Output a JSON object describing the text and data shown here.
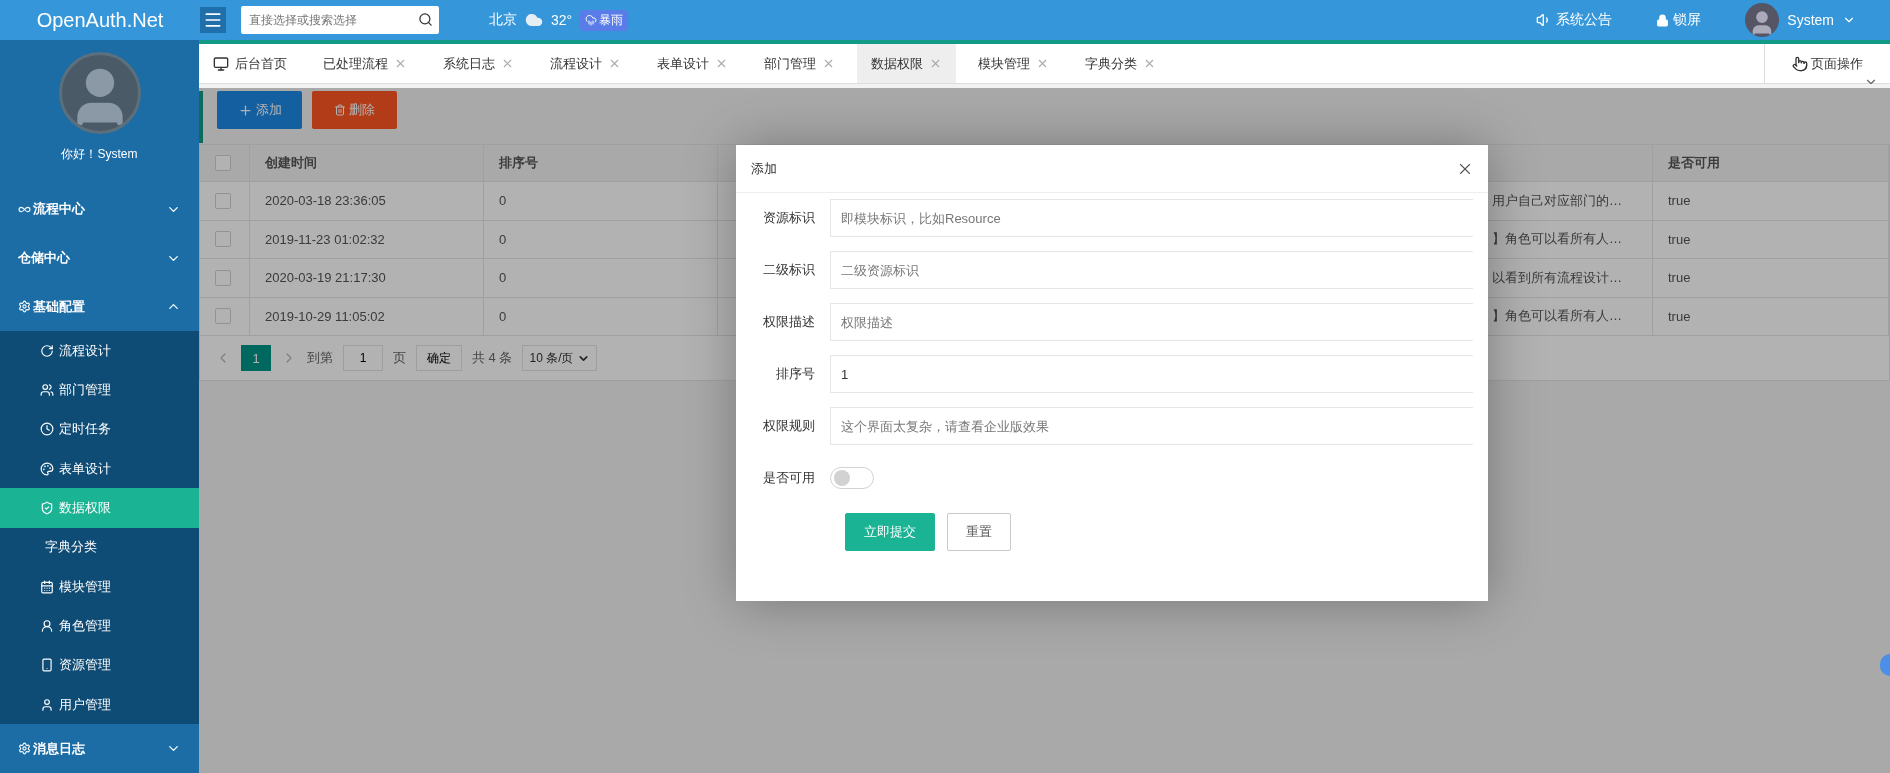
{
  "header": {
    "logo": "OpenAuth.Net",
    "search": {
      "placeholder": "直接选择或搜索选择"
    },
    "weather": {
      "city": "北京",
      "temperature": "32°",
      "condition": "暴雨"
    },
    "actions": [
      {
        "label": "系统公告",
        "kind": "notice"
      },
      {
        "label": "锁屏",
        "kind": "lock"
      }
    ],
    "user": "System"
  },
  "sidebar": {
    "greeting": "你好！System",
    "menu": [
      {
        "label": "流程中心",
        "expanded": false
      },
      {
        "label": "仓储中心",
        "expanded": false
      },
      {
        "label": "基础配置",
        "expanded": true,
        "children": [
          {
            "label": "流程设计",
            "selected": false
          },
          {
            "label": "部门管理",
            "selected": false
          },
          {
            "label": "定时任务",
            "selected": false
          },
          {
            "label": "表单设计",
            "selected": false
          },
          {
            "label": "数据权限",
            "selected": true
          },
          {
            "label": "字典分类",
            "selected": false
          },
          {
            "label": "模块管理",
            "selected": false
          },
          {
            "label": "角色管理",
            "selected": false
          },
          {
            "label": "资源管理",
            "selected": false
          },
          {
            "label": "用户管理",
            "selected": false
          }
        ]
      },
      {
        "label": "消息日志",
        "expanded": false
      }
    ]
  },
  "tabs": [
    {
      "label": "后台首页",
      "selected": false,
      "closable": false
    },
    {
      "label": "已处理流程",
      "selected": false,
      "closable": true
    },
    {
      "label": "系统日志",
      "selected": false,
      "closable": true
    },
    {
      "label": "流程设计",
      "selected": false,
      "closable": true
    },
    {
      "label": "表单设计",
      "selected": false,
      "closable": true
    },
    {
      "label": "部门管理",
      "selected": false,
      "closable": true
    },
    {
      "label": "数据权限",
      "selected": true,
      "closable": true
    },
    {
      "label": "模块管理",
      "selected": false,
      "closable": true
    },
    {
      "label": "字典分类",
      "selected": false,
      "closable": true
    }
  ],
  "page_actions": "页面操作",
  "toolbar": [
    {
      "label": "添加",
      "kind": "add"
    },
    {
      "label": "删除",
      "kind": "delete"
    }
  ],
  "table": {
    "all_checked": false,
    "columns": {
      "created": "创建时间",
      "sort": "排序号",
      "enabled": "是否可用"
    },
    "rows": [
      {
        "checked": false,
        "created": "2020-03-18 23:36:05",
        "sort": "0",
        "column_4": "用户自己对应部门的…",
        "enabled": "true"
      },
      {
        "checked": false,
        "created": "2019-11-23 01:02:32",
        "sort": "0",
        "column_4": "】角色可以看所有人…",
        "enabled": "true"
      },
      {
        "checked": false,
        "created": "2020-03-19 21:17:30",
        "sort": "0",
        "column_4": "以看到所有流程设计…",
        "enabled": "true"
      },
      {
        "checked": false,
        "created": "2019-10-29 11:05:02",
        "sort": "0",
        "column_4": "】角色可以看所有人…",
        "enabled": "true"
      }
    ]
  },
  "pagination": {
    "pages": [
      {
        "label": "1",
        "selected": true
      }
    ],
    "goto_label": "到第",
    "page_input": "1",
    "page_unit": "页",
    "confirm": "确定",
    "total": "共 4 条",
    "page_size": "10 条/页"
  },
  "dialog": {
    "title": "添加",
    "fields": [
      {
        "label": "资源标识",
        "kind": "text",
        "placeholder": "即模块标识，比如Resource"
      },
      {
        "label": "二级标识",
        "kind": "text",
        "placeholder": "二级资源标识"
      },
      {
        "label": "权限描述",
        "kind": "text",
        "placeholder": "权限描述"
      },
      {
        "label": "排序号",
        "kind": "text",
        "value": "1"
      },
      {
        "label": "权限规则",
        "kind": "text",
        "placeholder": "这个界面太复杂，请查看企业版效果"
      },
      {
        "label": "是否可用",
        "kind": "switch",
        "on": false
      }
    ],
    "buttons": [
      {
        "label": "立即提交",
        "kind": "primary"
      },
      {
        "label": "重置",
        "kind": "default"
      }
    ]
  }
}
